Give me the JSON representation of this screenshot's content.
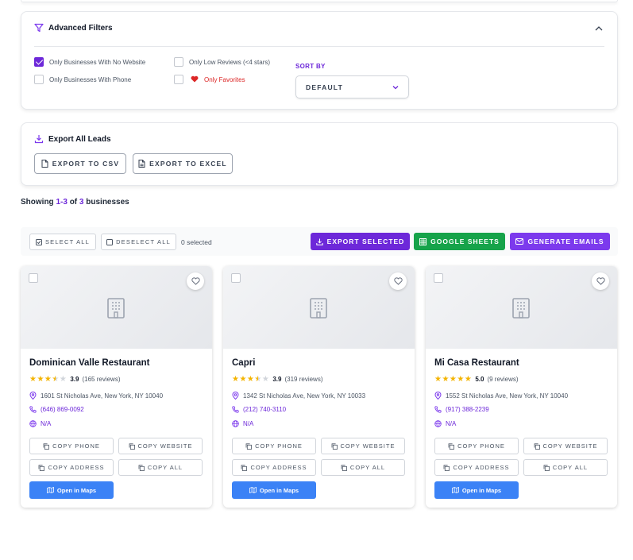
{
  "filters": {
    "title": "Advanced Filters",
    "options": [
      {
        "label": "Only Businesses With No Website",
        "checked": true
      },
      {
        "label": "Only Businesses With Phone",
        "checked": false
      },
      {
        "label": "Only Low Reviews (<4 stars)",
        "checked": false
      },
      {
        "label": "Only Favorites",
        "checked": false
      }
    ],
    "sort_label": "SORT BY",
    "sort_value": "DEFAULT"
  },
  "export": {
    "title": "Export All Leads",
    "csv_label": "EXPORT TO CSV",
    "excel_label": "EXPORT TO EXCEL"
  },
  "results": {
    "prefix": "Showing",
    "range": "1-3",
    "of": "of",
    "total": "3",
    "suffix": "businesses"
  },
  "toolbar": {
    "select_all": "SELECT ALL",
    "deselect_all": "DESELECT ALL",
    "selected_count": "0 selected",
    "export_selected": "EXPORT SELECTED",
    "google_sheets": "GOOGLE SHEETS",
    "generate_emails": "GENERATE EMAILS"
  },
  "colors": {
    "accent": "#6d28d9",
    "sheets": "#16a34a",
    "emails": "#7c3aed",
    "maps": "#3b82f6",
    "star": "#f4b400"
  },
  "card_buttons": {
    "copy_phone": "COPY PHONE",
    "copy_website": "COPY WEBSITE",
    "copy_address": "COPY ADDRESS",
    "copy_all": "COPY ALL",
    "open_maps": "Open in Maps"
  },
  "businesses": [
    {
      "name": "Dominican Valle Restaurant",
      "rating": "3.9",
      "reviews": "(165 reviews)",
      "stars": 3.9,
      "address": "1601 St Nicholas Ave, New York, NY 10040",
      "phone": "(646) 869-0092",
      "website": "N/A"
    },
    {
      "name": "Capri",
      "rating": "3.9",
      "reviews": "(319 reviews)",
      "stars": 3.9,
      "address": "1342 St Nicholas Ave, New York, NY 10033",
      "phone": "(212) 740-3110",
      "website": "N/A"
    },
    {
      "name": "Mi Casa Restaurant",
      "rating": "5.0",
      "reviews": "(9 reviews)",
      "stars": 5.0,
      "address": "1552 St Nicholas Ave, New York, NY 10040",
      "phone": "(917) 388-2239",
      "website": "N/A"
    }
  ]
}
